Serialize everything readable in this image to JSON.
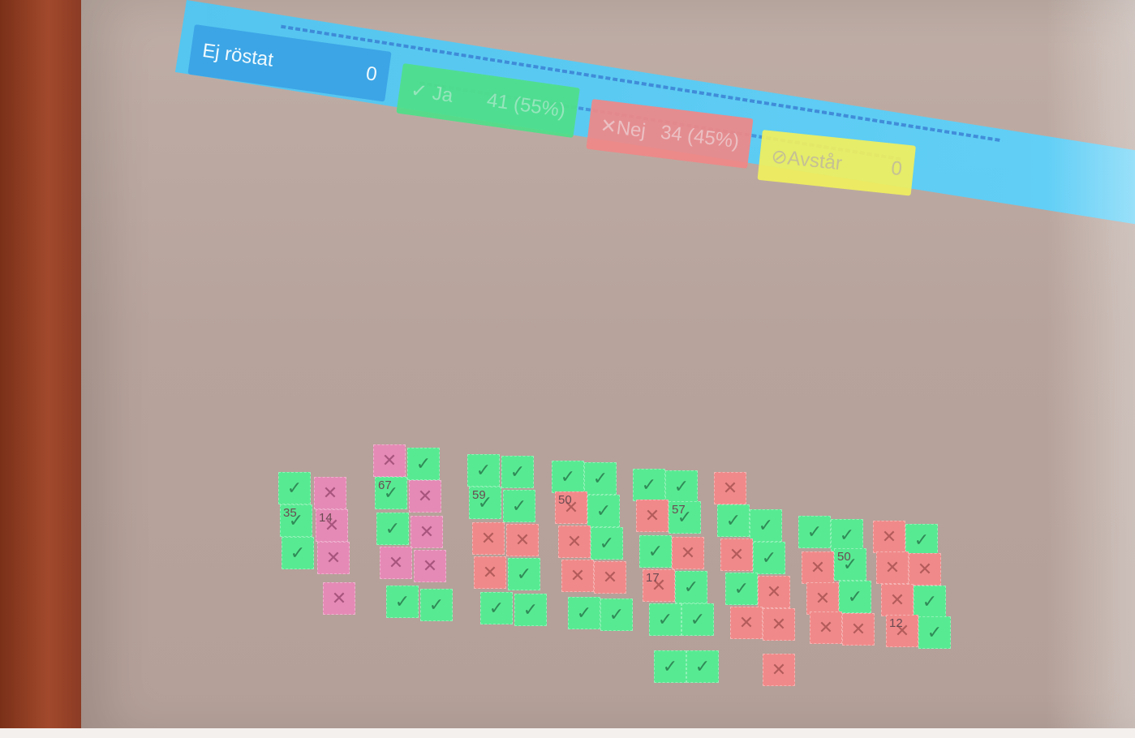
{
  "summary": {
    "not_voted": {
      "label": "Ej röstat",
      "value": "0",
      "color": "#3aa3e6"
    },
    "yes": {
      "label": "✓ Ja",
      "value": "41 (55%)",
      "color": "#4fe089"
    },
    "no": {
      "label": "✕Nej",
      "value": "34 (45%)",
      "color": "#f08888"
    },
    "abstain": {
      "label": "⊘Avstår",
      "value": "0",
      "color": "#f1f05e"
    }
  },
  "seat_symbols": {
    "yes": "✓",
    "no": "✕"
  },
  "seat_numbers": [
    "35",
    "14",
    "67",
    "59",
    "50",
    "57",
    "17",
    "12",
    "50"
  ]
}
